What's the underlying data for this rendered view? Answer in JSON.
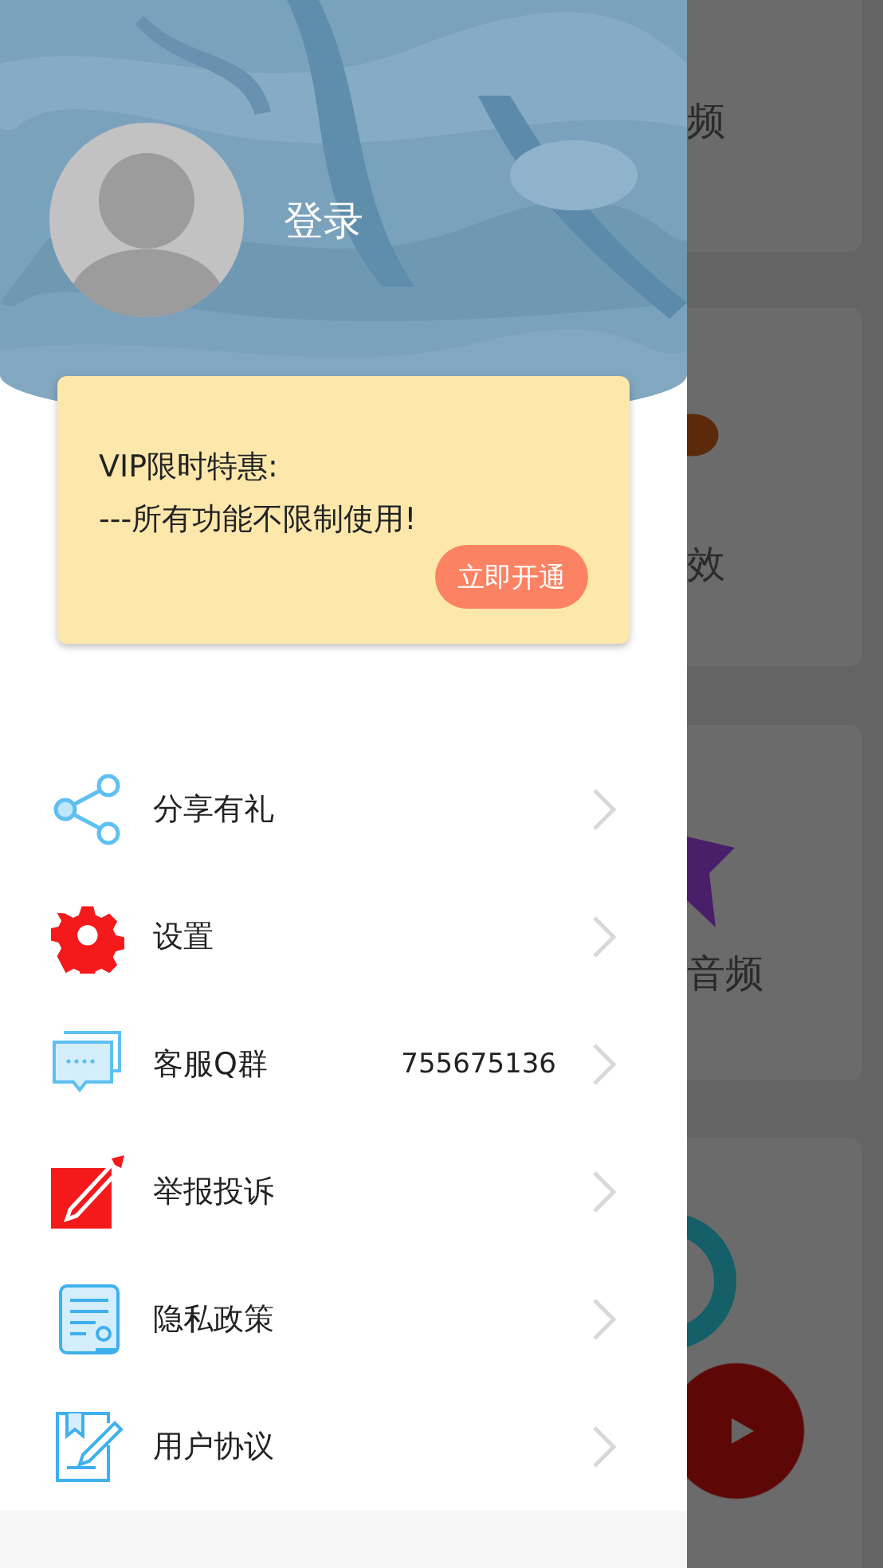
{
  "profile": {
    "login_label": "登录"
  },
  "vip": {
    "title": "VIP限时特惠:",
    "subtitle": "---所有功能不限制使用!",
    "button": "立即开通"
  },
  "menu": [
    {
      "label": "分享有礼"
    },
    {
      "label": "设置"
    },
    {
      "label": "客服Q群",
      "value": "755675136"
    },
    {
      "label": "举报投诉"
    },
    {
      "label": "隐私政策"
    },
    {
      "label": "用户协议"
    }
  ],
  "background_cards": [
    {
      "text": "频"
    },
    {
      "text": "效"
    },
    {
      "text": "音频"
    }
  ]
}
